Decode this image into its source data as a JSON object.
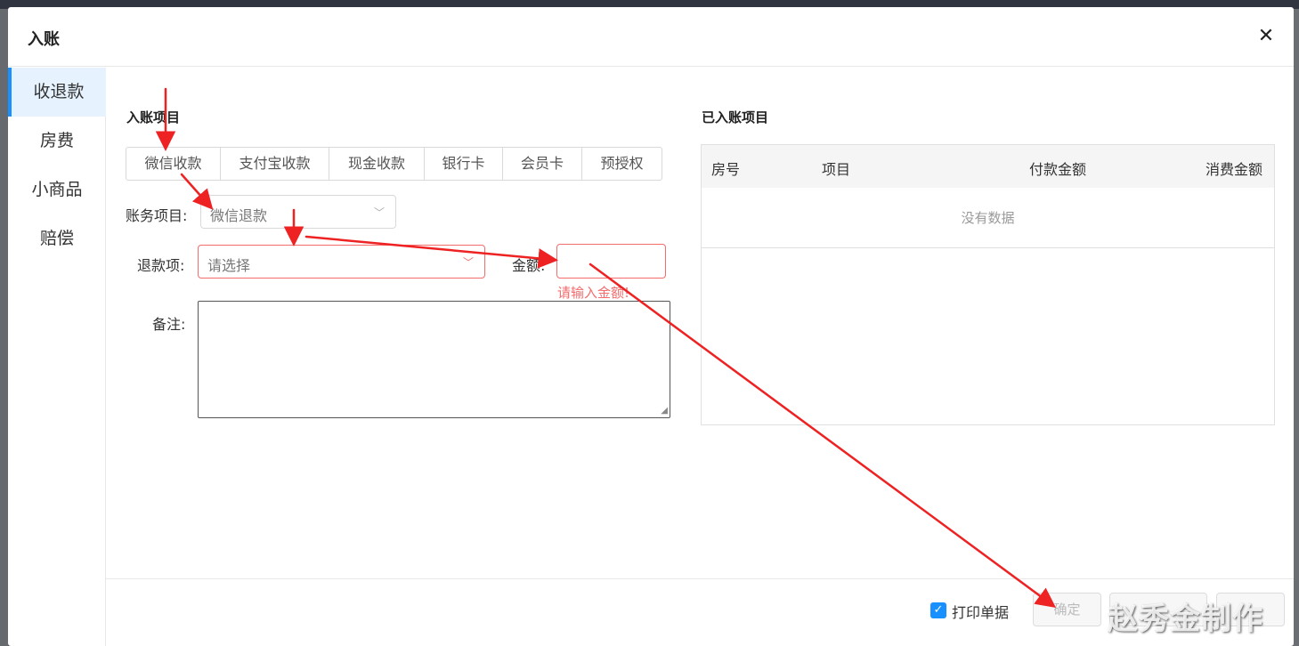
{
  "dialog": {
    "title": "入账",
    "close_glyph": "✕"
  },
  "sidebar": {
    "items": [
      {
        "label": "收退款"
      },
      {
        "label": "房费"
      },
      {
        "label": "小商品"
      },
      {
        "label": "赔偿"
      }
    ],
    "active_index": 0
  },
  "left_section": {
    "title": "入账项目"
  },
  "payment_tabs": [
    {
      "label": "微信收款"
    },
    {
      "label": "支付宝收款"
    },
    {
      "label": "现金收款"
    },
    {
      "label": "银行卡"
    },
    {
      "label": "会员卡"
    },
    {
      "label": "预授权"
    }
  ],
  "form": {
    "account_item": {
      "label": "账务项目:",
      "value": "微信退款"
    },
    "refund_item": {
      "label": "退款项:",
      "placeholder": "请选择"
    },
    "amount": {
      "label": "金额:",
      "value": "",
      "error": "请输入金额!"
    },
    "remark": {
      "label": "备注:",
      "value": ""
    }
  },
  "right_section": {
    "title": "已入账项目",
    "table": {
      "columns": [
        "房号",
        "项目",
        "付款金额",
        "消费金额"
      ],
      "empty_text": "没有数据",
      "rows": []
    }
  },
  "footer": {
    "print_receipt": {
      "label": "打印单据",
      "checked": true
    },
    "confirm_label": "确定"
  },
  "annotation_color": "#ee2222",
  "watermark": "赵秀金制作"
}
